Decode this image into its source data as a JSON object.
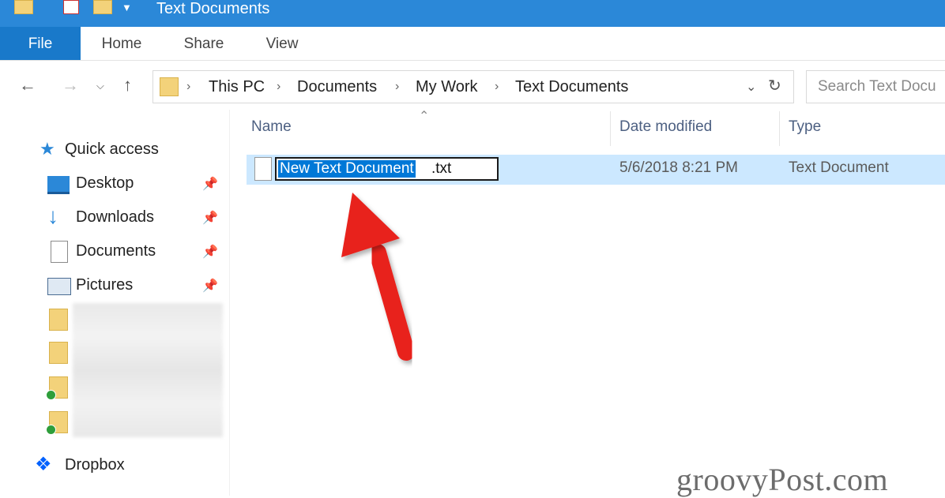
{
  "window": {
    "title": "Text Documents",
    "accent_color": "#2b88d8"
  },
  "ribbon": {
    "tabs": [
      {
        "label": "File"
      },
      {
        "label": "Home"
      },
      {
        "label": "Share"
      },
      {
        "label": "View"
      }
    ]
  },
  "address": {
    "crumbs": [
      "This PC",
      "Documents",
      "My Work",
      "Text Documents"
    ],
    "search_placeholder": "Search Text Docu"
  },
  "sidebar": {
    "quick_access": "Quick access",
    "items": [
      {
        "label": "Desktop",
        "icon": "desktop-icon",
        "pinned": true
      },
      {
        "label": "Downloads",
        "icon": "download-icon",
        "pinned": true
      },
      {
        "label": "Documents",
        "icon": "documents-icon",
        "pinned": true
      },
      {
        "label": "Pictures",
        "icon": "pictures-icon",
        "pinned": true
      }
    ],
    "dropbox": "Dropbox"
  },
  "file_list": {
    "columns": [
      "Name",
      "Date modified",
      "Type"
    ],
    "rows": [
      {
        "name_selected": "New Text Document",
        "name_ext": ".txt",
        "date_modified": "5/6/2018 8:21 PM",
        "type": "Text Document",
        "renaming": true
      }
    ]
  },
  "annotation": {
    "arrow_color": "#e8201c"
  },
  "watermark": "groovyPost.com"
}
